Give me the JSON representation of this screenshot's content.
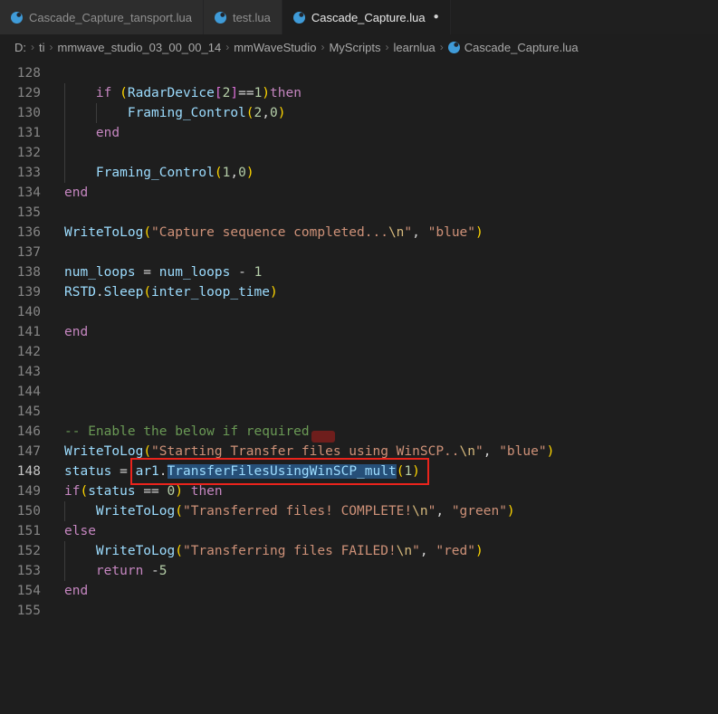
{
  "colors": {
    "annotation_red": "#ea241c",
    "selection_blue": "#264f78",
    "lua_icon_blue": "#3f9bd8",
    "keyword": "#c586c0",
    "string": "#ce9178",
    "comment": "#6a9955",
    "number": "#b5cea8",
    "identifier": "#9cdcfe"
  },
  "tabs": [
    {
      "label": "Cascade_Capture_tansport.lua",
      "active": false,
      "modified": false
    },
    {
      "label": "test.lua",
      "active": false,
      "modified": false
    },
    {
      "label": "Cascade_Capture.lua",
      "active": true,
      "modified": true
    }
  ],
  "modified_dot": "●",
  "breadcrumb": {
    "separator": "›",
    "items": [
      "D:",
      "ti",
      "mmwave_studio_03_00_00_14",
      "mmWaveStudio",
      "MyScripts",
      "learnlua",
      "Cascade_Capture.lua"
    ]
  },
  "code": {
    "lines": [
      {
        "num": 128,
        "guides": [],
        "tokens": []
      },
      {
        "num": 129,
        "guides": [
          0
        ],
        "tokens": [
          {
            "c": "pl",
            "t": "    "
          },
          {
            "c": "kw",
            "t": "if"
          },
          {
            "c": "pl",
            "t": " "
          },
          {
            "c": "b1",
            "t": "("
          },
          {
            "c": "id",
            "t": "RadarDevice"
          },
          {
            "c": "b2",
            "t": "["
          },
          {
            "c": "num",
            "t": "2"
          },
          {
            "c": "b2",
            "t": "]"
          },
          {
            "c": "pl",
            "t": "=="
          },
          {
            "c": "num",
            "t": "1"
          },
          {
            "c": "b1",
            "t": ")"
          },
          {
            "c": "kw",
            "t": "then"
          }
        ]
      },
      {
        "num": 130,
        "guides": [
          0,
          4
        ],
        "tokens": [
          {
            "c": "pl",
            "t": "        "
          },
          {
            "c": "id",
            "t": "Framing_Control"
          },
          {
            "c": "b1",
            "t": "("
          },
          {
            "c": "num",
            "t": "2"
          },
          {
            "c": "pl",
            "t": ","
          },
          {
            "c": "num",
            "t": "0"
          },
          {
            "c": "b1",
            "t": ")"
          }
        ]
      },
      {
        "num": 131,
        "guides": [
          0
        ],
        "tokens": [
          {
            "c": "pl",
            "t": "    "
          },
          {
            "c": "kw",
            "t": "end"
          }
        ]
      },
      {
        "num": 132,
        "guides": [
          0
        ],
        "tokens": []
      },
      {
        "num": 133,
        "guides": [
          0
        ],
        "tokens": [
          {
            "c": "pl",
            "t": "    "
          },
          {
            "c": "id",
            "t": "Framing_Control"
          },
          {
            "c": "b1",
            "t": "("
          },
          {
            "c": "num",
            "t": "1"
          },
          {
            "c": "pl",
            "t": ","
          },
          {
            "c": "num",
            "t": "0"
          },
          {
            "c": "b1",
            "t": ")"
          }
        ]
      },
      {
        "num": 134,
        "guides": [],
        "tokens": [
          {
            "c": "kw",
            "t": "end"
          }
        ]
      },
      {
        "num": 135,
        "guides": [],
        "tokens": []
      },
      {
        "num": 136,
        "guides": [],
        "tokens": [
          {
            "c": "id",
            "t": "WriteToLog"
          },
          {
            "c": "b1",
            "t": "("
          },
          {
            "c": "str",
            "t": "\"Capture sequence completed..."
          },
          {
            "c": "esc",
            "t": "\\n"
          },
          {
            "c": "str",
            "t": "\""
          },
          {
            "c": "pl",
            "t": ", "
          },
          {
            "c": "str",
            "t": "\"blue\""
          },
          {
            "c": "b1",
            "t": ")"
          }
        ]
      },
      {
        "num": 137,
        "guides": [],
        "tokens": []
      },
      {
        "num": 138,
        "guides": [],
        "tokens": [
          {
            "c": "id",
            "t": "num_loops"
          },
          {
            "c": "pl",
            "t": " = "
          },
          {
            "c": "id",
            "t": "num_loops"
          },
          {
            "c": "pl",
            "t": " - "
          },
          {
            "c": "num",
            "t": "1"
          }
        ]
      },
      {
        "num": 139,
        "guides": [],
        "tokens": [
          {
            "c": "id",
            "t": "RSTD"
          },
          {
            "c": "pl",
            "t": "."
          },
          {
            "c": "id",
            "t": "Sleep"
          },
          {
            "c": "b1",
            "t": "("
          },
          {
            "c": "id",
            "t": "inter_loop_time"
          },
          {
            "c": "b1",
            "t": ")"
          }
        ]
      },
      {
        "num": 140,
        "guides": [],
        "tokens": []
      },
      {
        "num": 141,
        "guides": [],
        "tokens": [
          {
            "c": "kw",
            "t": "end"
          }
        ]
      },
      {
        "num": 142,
        "guides": [],
        "tokens": []
      },
      {
        "num": 143,
        "guides": [],
        "tokens": []
      },
      {
        "num": 144,
        "guides": [],
        "tokens": []
      },
      {
        "num": 145,
        "guides": [],
        "tokens": []
      },
      {
        "num": 146,
        "guides": [],
        "tokens": [
          {
            "c": "cmt",
            "t": "-- Enable the below if required"
          }
        ]
      },
      {
        "num": 147,
        "guides": [],
        "tokens": [
          {
            "c": "id",
            "t": "WriteToLog"
          },
          {
            "c": "b1",
            "t": "("
          },
          {
            "c": "str",
            "t": "\"Starting Transfer files using WinSCP.."
          },
          {
            "c": "esc",
            "t": "\\n"
          },
          {
            "c": "str",
            "t": "\""
          },
          {
            "c": "pl",
            "t": ", "
          },
          {
            "c": "str",
            "t": "\"blue\""
          },
          {
            "c": "b1",
            "t": ")"
          }
        ]
      },
      {
        "num": 148,
        "guides": [],
        "active": true,
        "annotated": true,
        "tokens": [
          {
            "c": "id",
            "t": "status"
          },
          {
            "c": "pl",
            "t": " = "
          },
          {
            "c": "id",
            "t": "ar1"
          },
          {
            "c": "pl",
            "t": "."
          },
          {
            "c": "id sel",
            "t": "TransferFilesUsingWinSCP_mult"
          },
          {
            "c": "b1",
            "t": "("
          },
          {
            "c": "num",
            "t": "1"
          },
          {
            "c": "b1",
            "t": ")"
          }
        ]
      },
      {
        "num": 149,
        "guides": [],
        "tokens": [
          {
            "c": "kw",
            "t": "if"
          },
          {
            "c": "b1",
            "t": "("
          },
          {
            "c": "id",
            "t": "status"
          },
          {
            "c": "pl",
            "t": " == "
          },
          {
            "c": "num",
            "t": "0"
          },
          {
            "c": "b1",
            "t": ")"
          },
          {
            "c": "pl",
            "t": " "
          },
          {
            "c": "kw",
            "t": "then"
          }
        ]
      },
      {
        "num": 150,
        "guides": [
          0
        ],
        "tokens": [
          {
            "c": "pl",
            "t": "    "
          },
          {
            "c": "id",
            "t": "WriteToLog"
          },
          {
            "c": "b1",
            "t": "("
          },
          {
            "c": "str",
            "t": "\"Transferred files! COMPLETE!"
          },
          {
            "c": "esc",
            "t": "\\n"
          },
          {
            "c": "str",
            "t": "\""
          },
          {
            "c": "pl",
            "t": ", "
          },
          {
            "c": "str",
            "t": "\"green\""
          },
          {
            "c": "b1",
            "t": ")"
          }
        ]
      },
      {
        "num": 151,
        "guides": [],
        "tokens": [
          {
            "c": "kw",
            "t": "else"
          }
        ]
      },
      {
        "num": 152,
        "guides": [
          0
        ],
        "tokens": [
          {
            "c": "pl",
            "t": "    "
          },
          {
            "c": "id",
            "t": "WriteToLog"
          },
          {
            "c": "b1",
            "t": "("
          },
          {
            "c": "str",
            "t": "\"Transferring files FAILED!"
          },
          {
            "c": "esc",
            "t": "\\n"
          },
          {
            "c": "str",
            "t": "\""
          },
          {
            "c": "pl",
            "t": ", "
          },
          {
            "c": "str",
            "t": "\"red\""
          },
          {
            "c": "b1",
            "t": ")"
          }
        ]
      },
      {
        "num": 153,
        "guides": [
          0
        ],
        "tokens": [
          {
            "c": "pl",
            "t": "    "
          },
          {
            "c": "kw",
            "t": "return"
          },
          {
            "c": "pl",
            "t": " -"
          },
          {
            "c": "num",
            "t": "5"
          }
        ]
      },
      {
        "num": 154,
        "guides": [],
        "tokens": [
          {
            "c": "kw",
            "t": "end"
          }
        ]
      },
      {
        "num": 155,
        "guides": [],
        "tokens": []
      }
    ]
  }
}
